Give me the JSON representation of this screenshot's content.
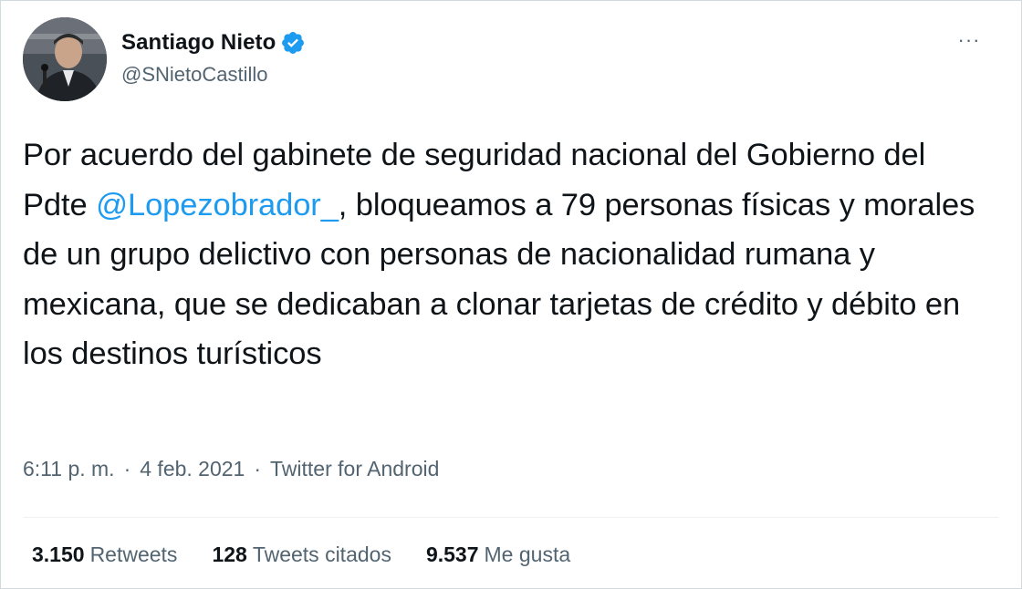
{
  "tweet": {
    "author": {
      "display_name": "Santiago Nieto",
      "handle": "@SNietoCastillo",
      "verified": true,
      "avatar_icon": "avatar-photo"
    },
    "more_icon": "more-horizontal-icon",
    "more_label": "···",
    "text": {
      "part1": "Por acuerdo del gabinete de seguridad nacional del Gobierno del Pdte ",
      "mention": "@Lopezobrador_",
      "part2": ", bloqueamos a 79 personas físicas y morales de un grupo delictivo con personas de nacionalidad rumana y mexicana, que se dedicaban a clonar tarjetas de crédito y débito en los destinos turísticos"
    },
    "meta": {
      "time": "6:11 p. m.",
      "separator": "·",
      "date": "4 feb. 2021",
      "source": "Twitter for Android"
    },
    "stats": [
      {
        "count": "3.150",
        "label": "Retweets"
      },
      {
        "count": "128",
        "label": "Tweets citados"
      },
      {
        "count": "9.537",
        "label": "Me gusta"
      }
    ]
  },
  "colors": {
    "accent": "#1d9bf0",
    "text_primary": "#0f1419",
    "text_secondary": "#536471",
    "border": "#cfd9de"
  }
}
